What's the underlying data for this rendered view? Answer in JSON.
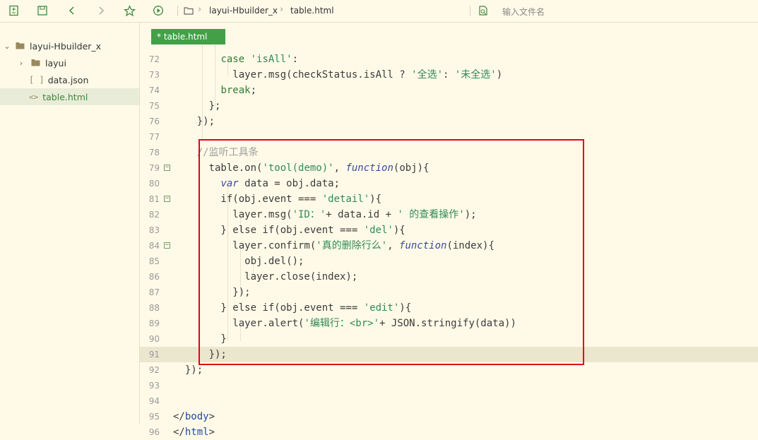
{
  "toolbar": {
    "breadcrumb": [
      "layui-Hbuilder_x",
      "table.html"
    ],
    "search_placeholder": "输入文件名",
    "icons": [
      "new-file-icon",
      "save-icon",
      "back-icon",
      "forward-icon",
      "star-icon",
      "run-icon",
      "folder-icon",
      "find-in-file-icon"
    ]
  },
  "sidebar": {
    "project": "layui-Hbuilder_x",
    "items": [
      {
        "label": "layui",
        "type": "folder"
      },
      {
        "label": "data.json",
        "type": "json"
      },
      {
        "label": "table.html",
        "type": "html",
        "selected": true
      }
    ]
  },
  "tab": {
    "label": "* table.html"
  },
  "editor": {
    "current_line": 91,
    "lines": [
      {
        "n": "72",
        "text": "        case 'isAll':"
      },
      {
        "n": "73",
        "text": "          layer.msg(checkStatus.isAll ? '全选': '未全选')"
      },
      {
        "n": "74",
        "text": "        break;"
      },
      {
        "n": "75",
        "text": "      };"
      },
      {
        "n": "76",
        "text": "    });"
      },
      {
        "n": "77",
        "text": ""
      },
      {
        "n": "78",
        "text": "    //监听工具条"
      },
      {
        "n": "79",
        "text": "      table.on('tool(demo)', function(obj){"
      },
      {
        "n": "80",
        "text": "        var data = obj.data;"
      },
      {
        "n": "81",
        "text": "        if(obj.event === 'detail'){"
      },
      {
        "n": "82",
        "text": "          layer.msg('ID：'+ data.id + ' 的查看操作');"
      },
      {
        "n": "83",
        "text": "        } else if(obj.event === 'del'){"
      },
      {
        "n": "84",
        "text": "          layer.confirm('真的删除行么', function(index){"
      },
      {
        "n": "85",
        "text": "            obj.del();"
      },
      {
        "n": "86",
        "text": "            layer.close(index);"
      },
      {
        "n": "87",
        "text": "          });"
      },
      {
        "n": "88",
        "text": "        } else if(obj.event === 'edit'){"
      },
      {
        "n": "89",
        "text": "          layer.alert('编辑行：<br>'+ JSON.stringify(data))"
      },
      {
        "n": "90",
        "text": "        }"
      },
      {
        "n": "91",
        "text": "      });"
      },
      {
        "n": "92",
        "text": "  });"
      },
      {
        "n": "93",
        "text": ""
      },
      {
        "n": "94",
        "text": ""
      },
      {
        "n": "95",
        "text": "</body>"
      },
      {
        "n": "96",
        "text": "</html>"
      }
    ]
  },
  "colors": {
    "accent": "#43a047",
    "highlight_box": "#e3001b",
    "background": "#fffae8"
  }
}
